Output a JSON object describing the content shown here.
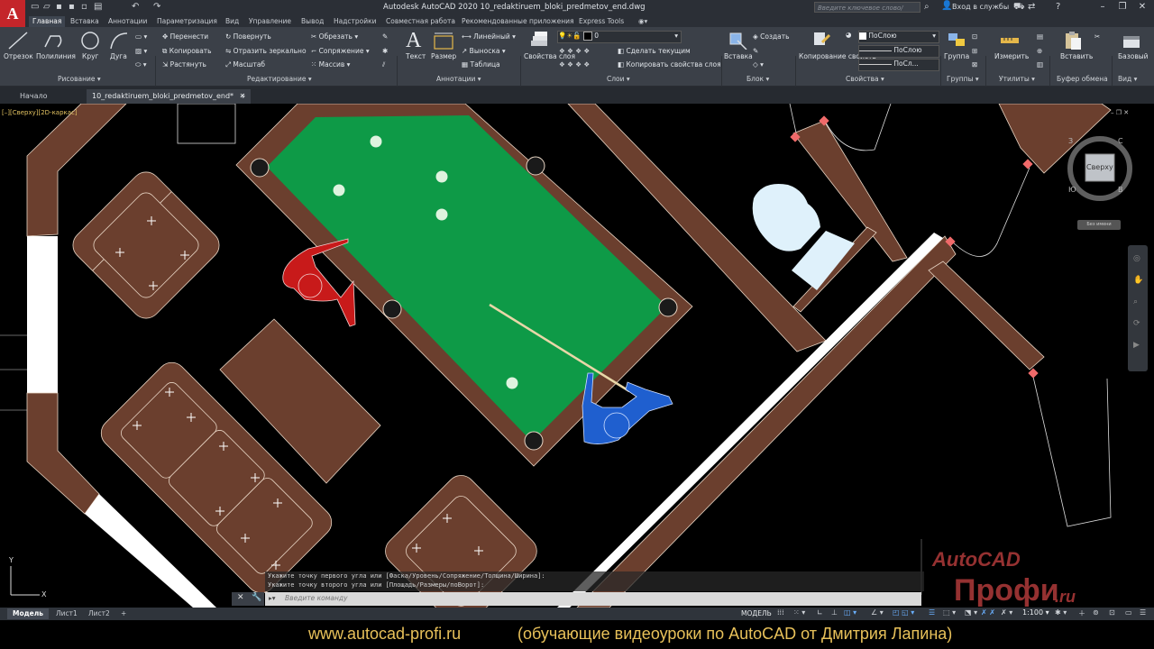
{
  "app": {
    "logo_letter": "A",
    "title": "Autodesk AutoCAD 2020   10_redaktiruem_bloki_predmetov_end.dwg",
    "search_placeholder": "Введите ключевое слово/фразу",
    "login_label": "Вход в службы"
  },
  "ribbon_tabs": [
    "Главная",
    "Вставка",
    "Аннотации",
    "Параметризация",
    "Вид",
    "Управление",
    "Вывод",
    "Надстройки",
    "Совместная работа",
    "Рекомендованные приложения",
    "Express Tools"
  ],
  "ribbon": {
    "draw": {
      "items": [
        "Отрезок",
        "Полилиния",
        "Круг",
        "Дуга"
      ],
      "label": "Рисование"
    },
    "modify": {
      "items": [
        "Перенести",
        "Копировать",
        "Растянуть",
        "Повернуть",
        "Отразить зеркально",
        "Масштаб",
        "Обрезать",
        "Сопряжение",
        "Массив"
      ],
      "label": "Редактирование"
    },
    "annotation": {
      "items": [
        "Текст",
        "Размер",
        "Линейный",
        "Выноска",
        "Таблица"
      ],
      "label": "Аннотации"
    },
    "layers": {
      "items": [
        "Свойства слоя",
        "Сделать текущим",
        "Копировать свойства слоя"
      ],
      "current_layer": "0",
      "label": "Слои"
    },
    "block": {
      "items": [
        "Вставка",
        "Создать"
      ],
      "label": "Блок"
    },
    "properties": {
      "items": [
        "Копирование свойств"
      ],
      "values": [
        "ПоСлою",
        "ПоСлою",
        "ПоСл..."
      ],
      "label": "Свойства"
    },
    "groups": {
      "items": [
        "Группа"
      ],
      "label": "Группы"
    },
    "utilities": {
      "items": [
        "Измерить"
      ],
      "label": "Утилиты"
    },
    "clipboard": {
      "items": [
        "Вставить"
      ],
      "label": "Буфер обмена"
    },
    "view": {
      "items": [
        "Базовый"
      ],
      "label": "Вид"
    }
  },
  "file_tabs": [
    "Начало",
    "10_redaktiruem_bloki_predmetov_end*"
  ],
  "viewport": {
    "label": "[–][Сверху][2D-каркас]",
    "viewcube_face": "Сверху",
    "viewcube_dirs": [
      "С",
      "В",
      "Ю",
      "З"
    ],
    "wcs_label": "Без имени"
  },
  "command": {
    "history": [
      "Укажите точку первого угла или [Фаска/Уровень/Сопряжение/Толщина/Ширина]:",
      "Укажите точку второго угла или [Площадь/Размеры/поВорот]:"
    ],
    "placeholder": "Введите команду"
  },
  "status": {
    "layout_tabs": [
      "Модель",
      "Лист1",
      "Лист2"
    ],
    "model_label": "МОДЕЛЬ",
    "scale": "1:100"
  },
  "footer": {
    "url": "www.autocad-profi.ru",
    "description": "(обучающие видеоуроки по AutoCAD от Дмитрия Лапина)"
  },
  "watermark": {
    "line1": "AutoCAD",
    "line2": "Профи",
    "line3": ".ru"
  },
  "colors": {
    "table_felt": "#0e9a47",
    "wood": "#6b3f2e",
    "player_red": "#c81a1a",
    "player_blue": "#1f5fcf",
    "accent_footer": "#e8c15a"
  }
}
